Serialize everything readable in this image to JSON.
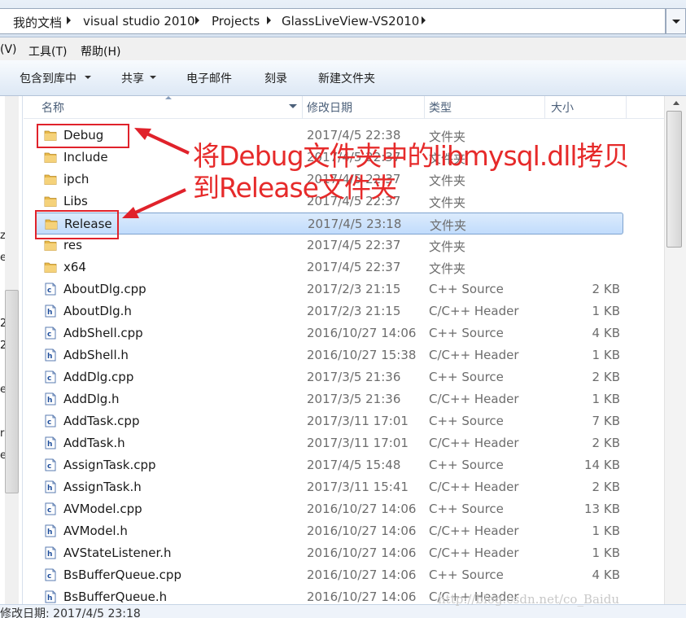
{
  "breadcrumbs": [
    "我的文档",
    "visual studio 2010",
    "Projects",
    "GlassLiveView-VS2010"
  ],
  "menu": [
    "(V)",
    "工具(T)",
    "帮助(H)"
  ],
  "toolbar": [
    {
      "label": "包含到库中",
      "dropdown": true
    },
    {
      "label": "共享",
      "dropdown": true
    },
    {
      "label": "电子邮件",
      "dropdown": false
    },
    {
      "label": "刻录",
      "dropdown": false
    },
    {
      "label": "新建文件夹",
      "dropdown": false
    }
  ],
  "columns": {
    "name": "名称",
    "date": "修改日期",
    "type": "类型",
    "size": "大小"
  },
  "nav_fragments": [
    "z",
    "e",
    "2",
    "2",
    "e",
    "ri",
    "e"
  ],
  "files": [
    {
      "name": "Debug",
      "date": "2017/4/5 22:38",
      "type": "文件夹",
      "size": "",
      "icon": "folder-icon"
    },
    {
      "name": "Include",
      "date": "2017/4/5 22:37",
      "type": "文件夹",
      "size": "",
      "icon": "folder-icon"
    },
    {
      "name": "ipch",
      "date": "2017/4/5 22:37",
      "type": "文件夹",
      "size": "",
      "icon": "folder-icon"
    },
    {
      "name": "Libs",
      "date": "2017/4/5 22:37",
      "type": "文件夹",
      "size": "",
      "icon": "folder-icon"
    },
    {
      "name": "Release",
      "date": "2017/4/5 23:18",
      "type": "文件夹",
      "size": "",
      "icon": "folder-icon",
      "selected": true
    },
    {
      "name": "res",
      "date": "2017/4/5 22:37",
      "type": "文件夹",
      "size": "",
      "icon": "folder-icon"
    },
    {
      "name": "x64",
      "date": "2017/4/5 22:37",
      "type": "文件夹",
      "size": "",
      "icon": "folder-icon"
    },
    {
      "name": "AboutDlg.cpp",
      "date": "2017/2/3 21:15",
      "type": "C++ Source",
      "size": "2 KB",
      "icon": "cpp-file-icon"
    },
    {
      "name": "AboutDlg.h",
      "date": "2017/2/3 21:15",
      "type": "C/C++ Header",
      "size": "1 KB",
      "icon": "header-file-icon"
    },
    {
      "name": "AdbShell.cpp",
      "date": "2016/10/27 14:06",
      "type": "C++ Source",
      "size": "4 KB",
      "icon": "cpp-file-icon"
    },
    {
      "name": "AdbShell.h",
      "date": "2016/10/27 15:38",
      "type": "C/C++ Header",
      "size": "1 KB",
      "icon": "header-file-icon"
    },
    {
      "name": "AddDlg.cpp",
      "date": "2017/3/5 21:36",
      "type": "C++ Source",
      "size": "2 KB",
      "icon": "cpp-file-icon"
    },
    {
      "name": "AddDlg.h",
      "date": "2017/3/5 21:36",
      "type": "C/C++ Header",
      "size": "1 KB",
      "icon": "header-file-icon"
    },
    {
      "name": "AddTask.cpp",
      "date": "2017/3/11 17:01",
      "type": "C++ Source",
      "size": "7 KB",
      "icon": "cpp-file-icon"
    },
    {
      "name": "AddTask.h",
      "date": "2017/3/11 17:01",
      "type": "C/C++ Header",
      "size": "2 KB",
      "icon": "header-file-icon"
    },
    {
      "name": "AssignTask.cpp",
      "date": "2017/4/5 15:48",
      "type": "C++ Source",
      "size": "14 KB",
      "icon": "cpp-file-icon"
    },
    {
      "name": "AssignTask.h",
      "date": "2017/3/11 15:41",
      "type": "C/C++ Header",
      "size": "2 KB",
      "icon": "header-file-icon"
    },
    {
      "name": "AVModel.cpp",
      "date": "2016/10/27 14:06",
      "type": "C++ Source",
      "size": "13 KB",
      "icon": "cpp-file-icon"
    },
    {
      "name": "AVModel.h",
      "date": "2016/10/27 14:06",
      "type": "C/C++ Header",
      "size": "1 KB",
      "icon": "header-file-icon"
    },
    {
      "name": "AVStateListener.h",
      "date": "2016/10/27 14:06",
      "type": "C/C++ Header",
      "size": "1 KB",
      "icon": "header-file-icon"
    },
    {
      "name": "BsBufferQueue.cpp",
      "date": "2016/10/27 14:06",
      "type": "C++ Source",
      "size": "4 KB",
      "icon": "cpp-file-icon"
    },
    {
      "name": "BsBufferQueue.h",
      "date": "2016/10/27 14:06",
      "type": "C/C++ Header",
      "size": "",
      "icon": "header-file-icon"
    }
  ],
  "status": "修改日期: 2017/4/5 23:18",
  "annotation": {
    "line1": "将Debug文件夹中的libmysql.dll拷贝",
    "line2": "到Release文件夹",
    "color": "#e62a2a"
  },
  "watermark": "http://blog.csdn.net/co_Baidu",
  "colors": {
    "selection": "#c1dcfc",
    "accent_red": "#e0222b",
    "folder": "#e8b94a"
  }
}
